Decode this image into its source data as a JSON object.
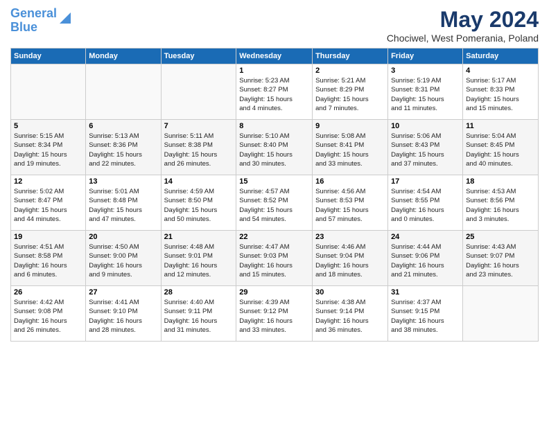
{
  "logo": {
    "line1": "General",
    "line2": "Blue"
  },
  "title": "May 2024",
  "location": "Chociwel, West Pomerania, Poland",
  "days_of_week": [
    "Sunday",
    "Monday",
    "Tuesday",
    "Wednesday",
    "Thursday",
    "Friday",
    "Saturday"
  ],
  "weeks": [
    [
      {
        "day": "",
        "info": ""
      },
      {
        "day": "",
        "info": ""
      },
      {
        "day": "",
        "info": ""
      },
      {
        "day": "1",
        "info": "Sunrise: 5:23 AM\nSunset: 8:27 PM\nDaylight: 15 hours\nand 4 minutes."
      },
      {
        "day": "2",
        "info": "Sunrise: 5:21 AM\nSunset: 8:29 PM\nDaylight: 15 hours\nand 7 minutes."
      },
      {
        "day": "3",
        "info": "Sunrise: 5:19 AM\nSunset: 8:31 PM\nDaylight: 15 hours\nand 11 minutes."
      },
      {
        "day": "4",
        "info": "Sunrise: 5:17 AM\nSunset: 8:33 PM\nDaylight: 15 hours\nand 15 minutes."
      }
    ],
    [
      {
        "day": "5",
        "info": "Sunrise: 5:15 AM\nSunset: 8:34 PM\nDaylight: 15 hours\nand 19 minutes."
      },
      {
        "day": "6",
        "info": "Sunrise: 5:13 AM\nSunset: 8:36 PM\nDaylight: 15 hours\nand 22 minutes."
      },
      {
        "day": "7",
        "info": "Sunrise: 5:11 AM\nSunset: 8:38 PM\nDaylight: 15 hours\nand 26 minutes."
      },
      {
        "day": "8",
        "info": "Sunrise: 5:10 AM\nSunset: 8:40 PM\nDaylight: 15 hours\nand 30 minutes."
      },
      {
        "day": "9",
        "info": "Sunrise: 5:08 AM\nSunset: 8:41 PM\nDaylight: 15 hours\nand 33 minutes."
      },
      {
        "day": "10",
        "info": "Sunrise: 5:06 AM\nSunset: 8:43 PM\nDaylight: 15 hours\nand 37 minutes."
      },
      {
        "day": "11",
        "info": "Sunrise: 5:04 AM\nSunset: 8:45 PM\nDaylight: 15 hours\nand 40 minutes."
      }
    ],
    [
      {
        "day": "12",
        "info": "Sunrise: 5:02 AM\nSunset: 8:47 PM\nDaylight: 15 hours\nand 44 minutes."
      },
      {
        "day": "13",
        "info": "Sunrise: 5:01 AM\nSunset: 8:48 PM\nDaylight: 15 hours\nand 47 minutes."
      },
      {
        "day": "14",
        "info": "Sunrise: 4:59 AM\nSunset: 8:50 PM\nDaylight: 15 hours\nand 50 minutes."
      },
      {
        "day": "15",
        "info": "Sunrise: 4:57 AM\nSunset: 8:52 PM\nDaylight: 15 hours\nand 54 minutes."
      },
      {
        "day": "16",
        "info": "Sunrise: 4:56 AM\nSunset: 8:53 PM\nDaylight: 15 hours\nand 57 minutes."
      },
      {
        "day": "17",
        "info": "Sunrise: 4:54 AM\nSunset: 8:55 PM\nDaylight: 16 hours\nand 0 minutes."
      },
      {
        "day": "18",
        "info": "Sunrise: 4:53 AM\nSunset: 8:56 PM\nDaylight: 16 hours\nand 3 minutes."
      }
    ],
    [
      {
        "day": "19",
        "info": "Sunrise: 4:51 AM\nSunset: 8:58 PM\nDaylight: 16 hours\nand 6 minutes."
      },
      {
        "day": "20",
        "info": "Sunrise: 4:50 AM\nSunset: 9:00 PM\nDaylight: 16 hours\nand 9 minutes."
      },
      {
        "day": "21",
        "info": "Sunrise: 4:48 AM\nSunset: 9:01 PM\nDaylight: 16 hours\nand 12 minutes."
      },
      {
        "day": "22",
        "info": "Sunrise: 4:47 AM\nSunset: 9:03 PM\nDaylight: 16 hours\nand 15 minutes."
      },
      {
        "day": "23",
        "info": "Sunrise: 4:46 AM\nSunset: 9:04 PM\nDaylight: 16 hours\nand 18 minutes."
      },
      {
        "day": "24",
        "info": "Sunrise: 4:44 AM\nSunset: 9:06 PM\nDaylight: 16 hours\nand 21 minutes."
      },
      {
        "day": "25",
        "info": "Sunrise: 4:43 AM\nSunset: 9:07 PM\nDaylight: 16 hours\nand 23 minutes."
      }
    ],
    [
      {
        "day": "26",
        "info": "Sunrise: 4:42 AM\nSunset: 9:08 PM\nDaylight: 16 hours\nand 26 minutes."
      },
      {
        "day": "27",
        "info": "Sunrise: 4:41 AM\nSunset: 9:10 PM\nDaylight: 16 hours\nand 28 minutes."
      },
      {
        "day": "28",
        "info": "Sunrise: 4:40 AM\nSunset: 9:11 PM\nDaylight: 16 hours\nand 31 minutes."
      },
      {
        "day": "29",
        "info": "Sunrise: 4:39 AM\nSunset: 9:12 PM\nDaylight: 16 hours\nand 33 minutes."
      },
      {
        "day": "30",
        "info": "Sunrise: 4:38 AM\nSunset: 9:14 PM\nDaylight: 16 hours\nand 36 minutes."
      },
      {
        "day": "31",
        "info": "Sunrise: 4:37 AM\nSunset: 9:15 PM\nDaylight: 16 hours\nand 38 minutes."
      },
      {
        "day": "",
        "info": ""
      }
    ]
  ]
}
